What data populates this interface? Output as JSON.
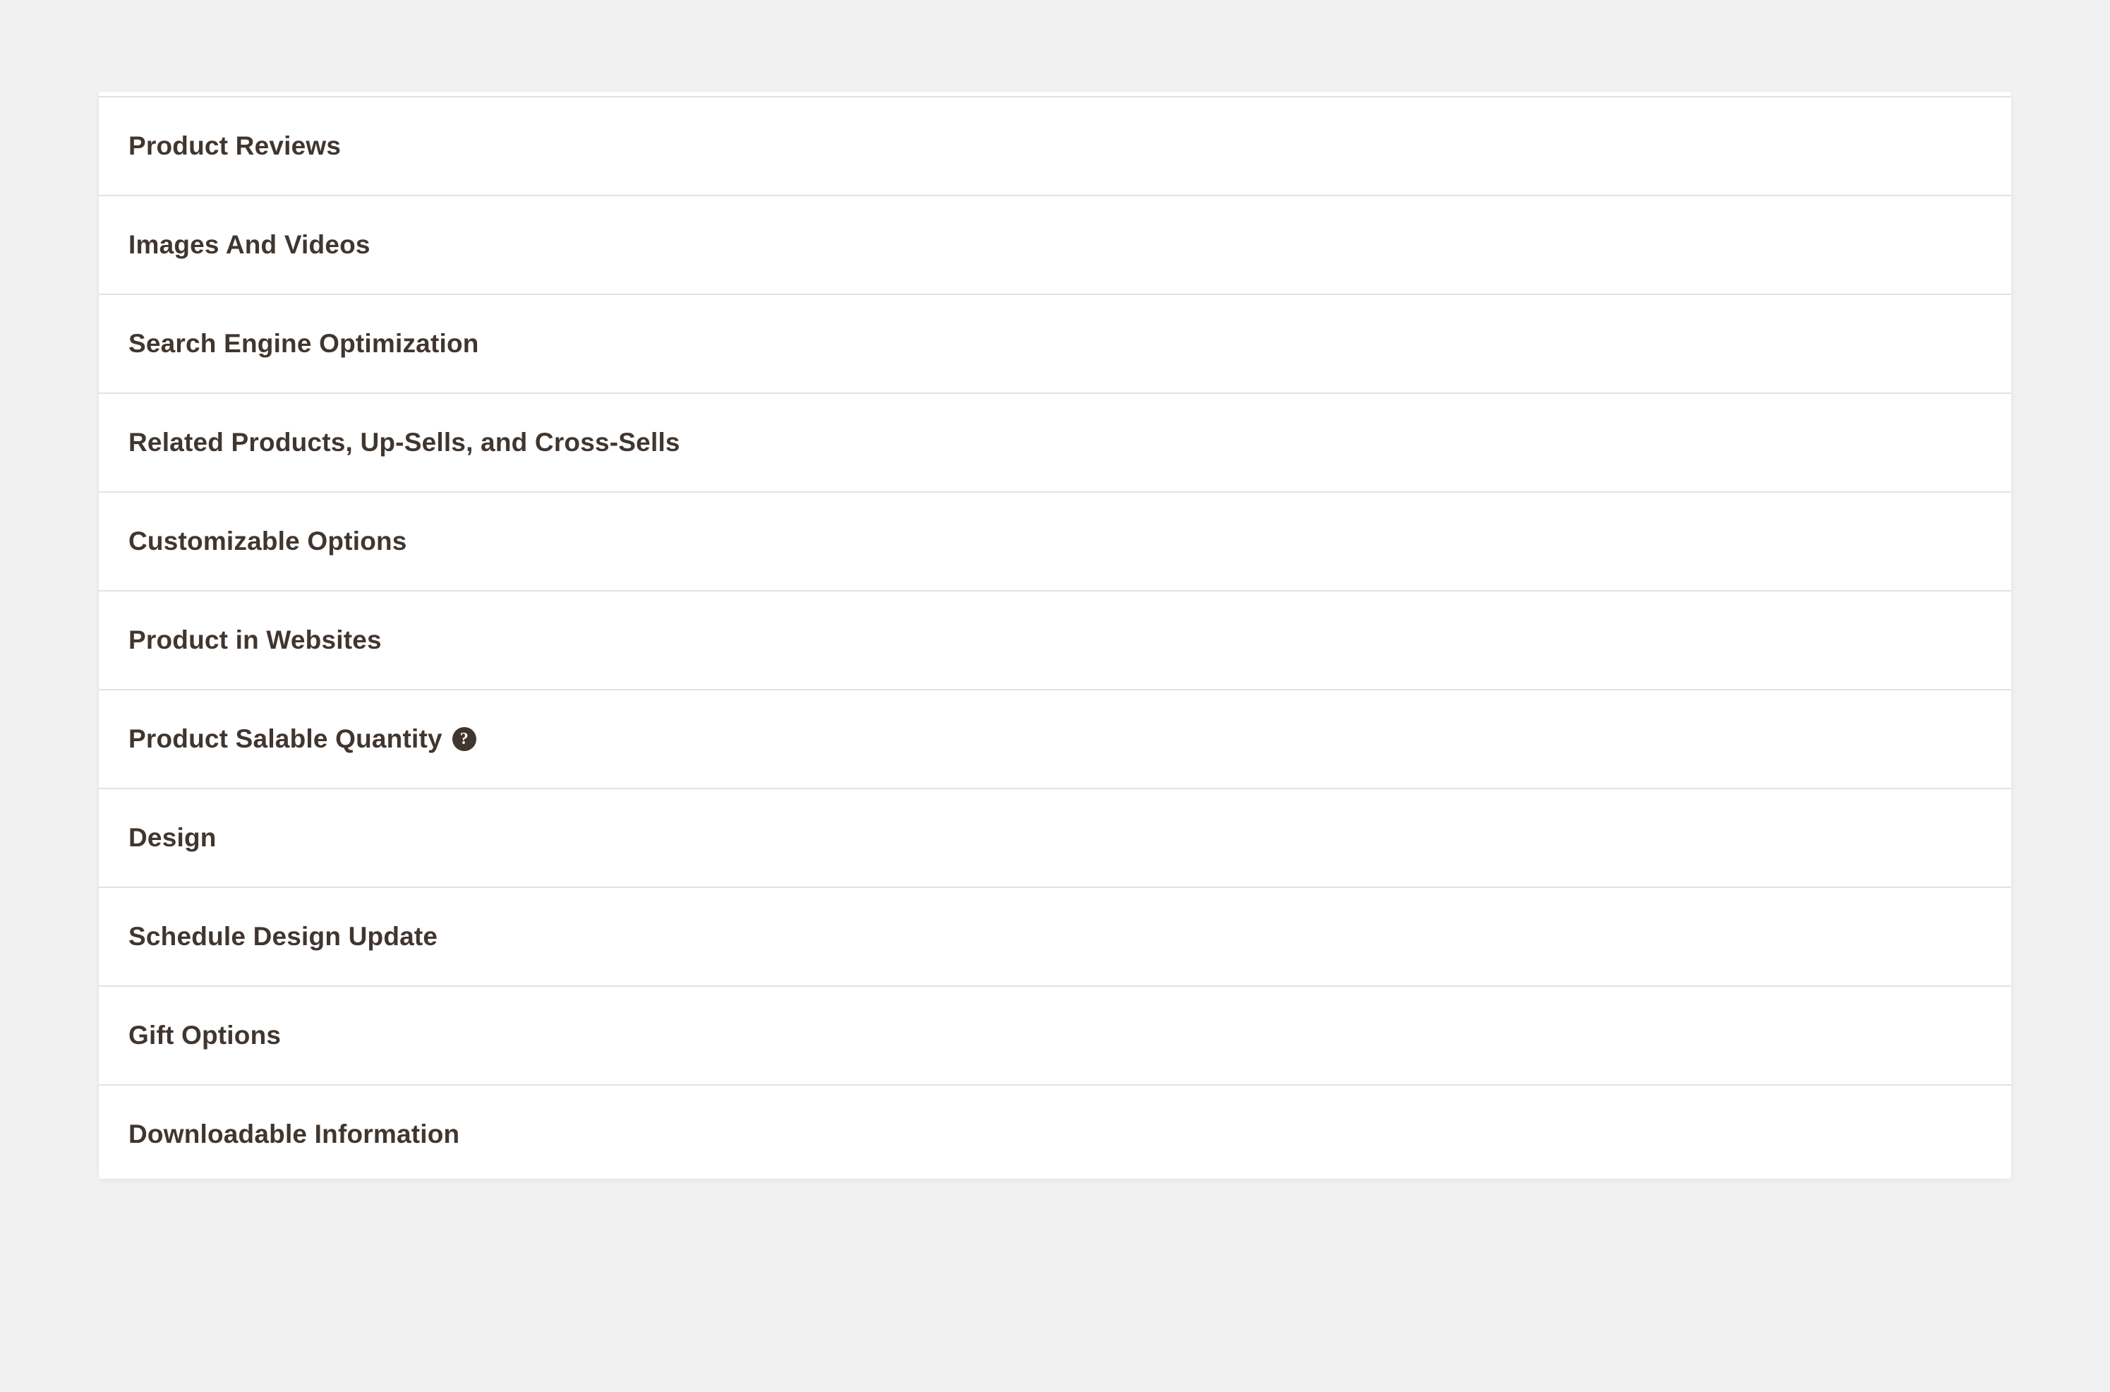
{
  "sections": [
    {
      "label": "Product Reviews",
      "hasHelp": false
    },
    {
      "label": "Images And Videos",
      "hasHelp": false
    },
    {
      "label": "Search Engine Optimization",
      "hasHelp": false
    },
    {
      "label": "Related Products, Up-Sells, and Cross-Sells",
      "hasHelp": false
    },
    {
      "label": "Customizable Options",
      "hasHelp": false
    },
    {
      "label": "Product in Websites",
      "hasHelp": false
    },
    {
      "label": "Product Salable Quantity",
      "hasHelp": true
    },
    {
      "label": "Design",
      "hasHelp": false
    },
    {
      "label": "Schedule Design Update",
      "hasHelp": false
    },
    {
      "label": "Gift Options",
      "hasHelp": false
    },
    {
      "label": "Downloadable Information",
      "hasHelp": false
    }
  ],
  "helpGlyph": "?"
}
